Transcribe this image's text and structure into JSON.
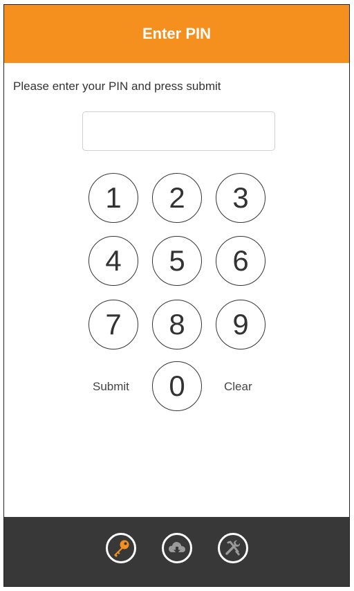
{
  "header": {
    "title": "Enter PIN"
  },
  "instruction": "Please enter your PIN and press submit",
  "pin": {
    "value": "",
    "placeholder": ""
  },
  "keypad": {
    "keys": [
      "1",
      "2",
      "3",
      "4",
      "5",
      "6",
      "7",
      "8",
      "9",
      "0"
    ],
    "submit_label": "Submit",
    "clear_label": "Clear"
  },
  "footer": {
    "icons": [
      "key-icon",
      "cloud-download-icon",
      "tools-icon"
    ]
  },
  "colors": {
    "accent": "#f5901f",
    "footer_bg": "#383838",
    "text": "#333333"
  }
}
